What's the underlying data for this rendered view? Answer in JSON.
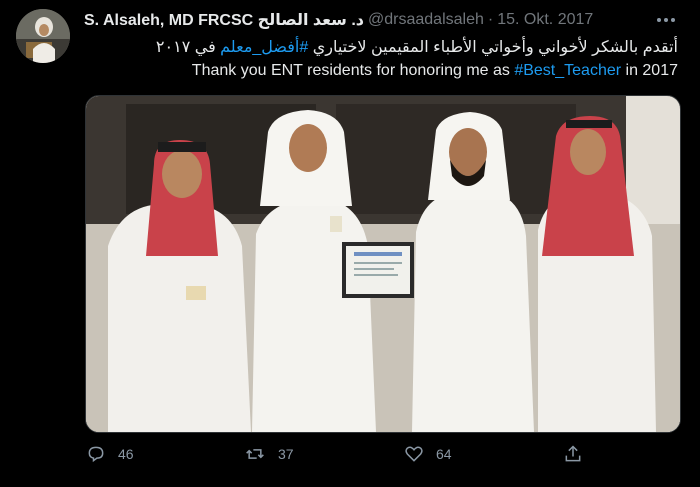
{
  "tweet": {
    "display_name": "S. Alsaleh, MD FRCSC د. سعد الصالح",
    "handle": "@drsaadalsaleh",
    "separator": "·",
    "date": "15. Okt. 2017",
    "text_ar_before": "أتقدم بالشكر لأخواني وأخواتي الأطباء المقيمين لاختياري ",
    "hashtag_ar": "#أفضل_معلم",
    "text_ar_after": " في ٢٠١٧",
    "text_en_before": "Thank you ENT residents for honoring me as ",
    "hashtag_en": "#Best_Teacher",
    "text_en_after": " in 2017"
  },
  "actions": {
    "replies": "46",
    "retweets": "37",
    "likes": "64"
  },
  "icons": {
    "more": "more-horizontal-icon",
    "reply": "reply-icon",
    "retweet": "retweet-icon",
    "like": "heart-icon",
    "share": "share-icon"
  },
  "colors": {
    "background": "#000000",
    "text": "#e7e9ea",
    "secondary": "#71767b",
    "link": "#1d9bf0"
  }
}
